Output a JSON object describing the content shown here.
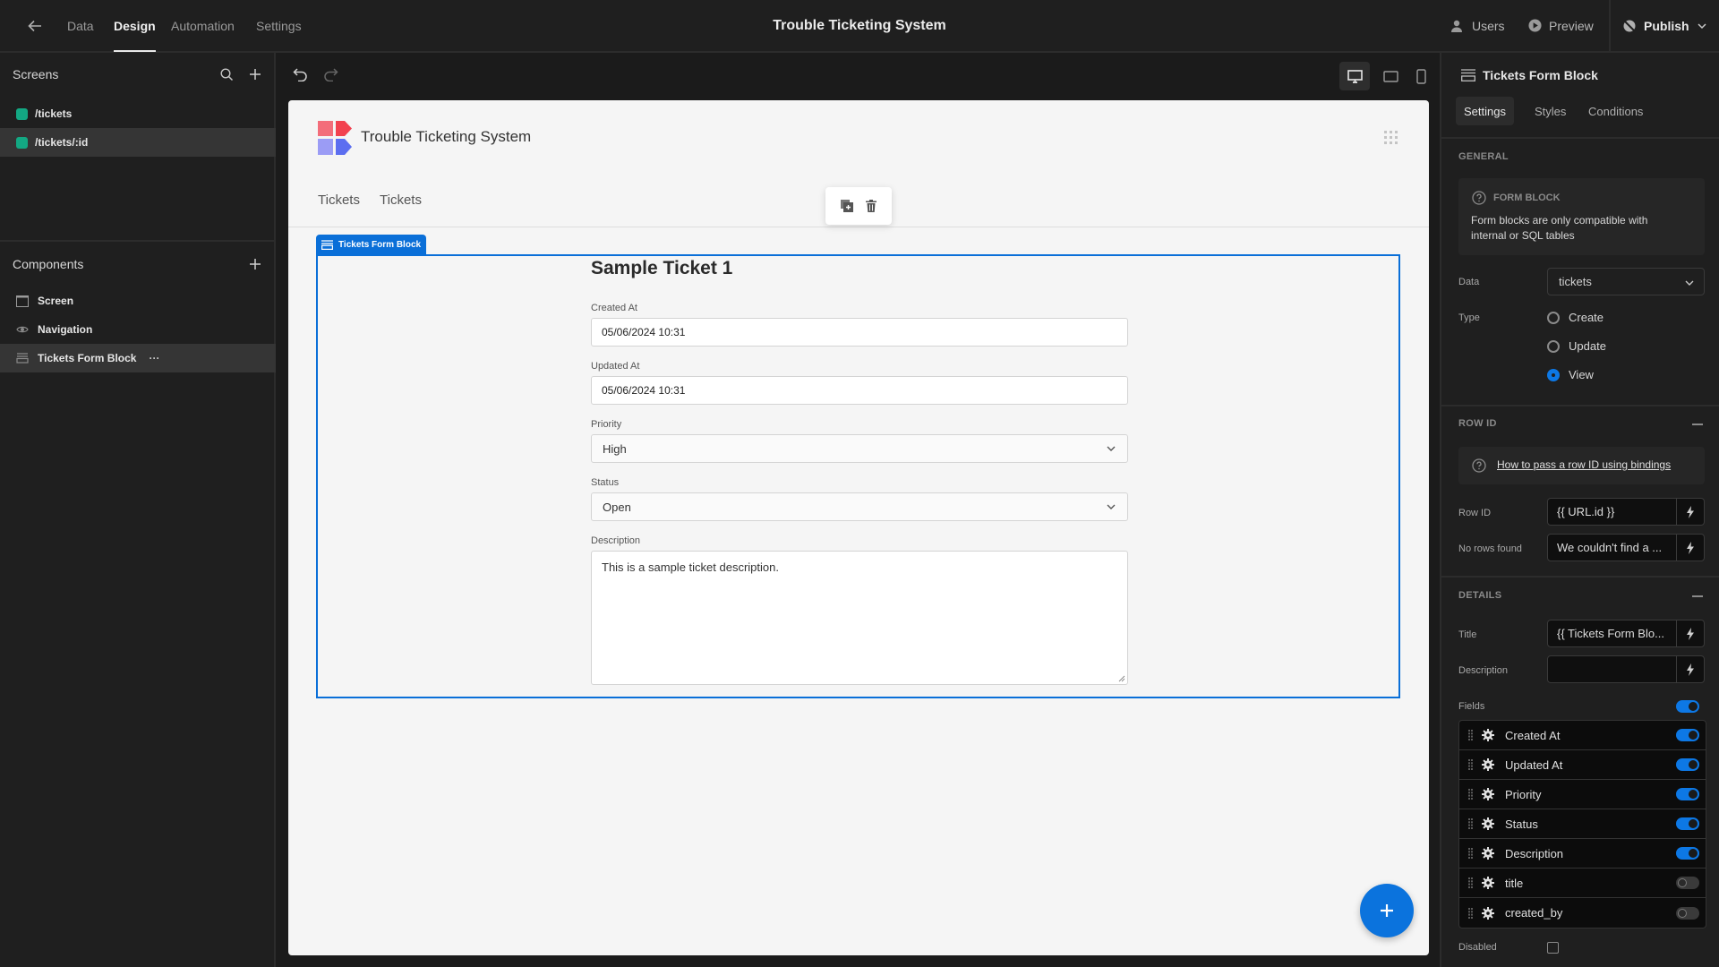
{
  "topbar": {
    "back_icon": "arrow-left-icon",
    "nav": [
      {
        "label": "Data",
        "active": false
      },
      {
        "label": "Design",
        "active": true
      },
      {
        "label": "Automation",
        "active": false
      },
      {
        "label": "Settings",
        "active": false
      }
    ],
    "title": "Trouble Ticketing System",
    "users_label": "Users",
    "preview_label": "Preview",
    "publish_label": "Publish"
  },
  "left_panel": {
    "screens_heading": "Screens",
    "screens": [
      {
        "path": "/tickets",
        "color": "#13a883",
        "selected": false
      },
      {
        "path": "/tickets/:id",
        "color": "#13a883",
        "selected": true
      }
    ],
    "components_heading": "Components",
    "components": [
      {
        "label": "Screen",
        "icon": "screen-icon",
        "selected": false
      },
      {
        "label": "Navigation",
        "icon": "eye-icon",
        "selected": false
      },
      {
        "label": "Tickets Form Block",
        "icon": "form-icon",
        "selected": true,
        "more": "···"
      }
    ]
  },
  "canvas": {
    "app_name": "Trouble Ticketing System",
    "nav_links": [
      "Tickets",
      "Tickets"
    ],
    "block_tab_label": "Tickets Form Block",
    "form": {
      "title": "Sample Ticket 1",
      "fields": [
        {
          "label": "Created At",
          "value": "05/06/2024 10:31",
          "type": "datetime"
        },
        {
          "label": "Updated At",
          "value": "05/06/2024 10:31",
          "type": "datetime"
        },
        {
          "label": "Priority",
          "value": "High",
          "type": "select"
        },
        {
          "label": "Status",
          "value": "Open",
          "type": "select"
        },
        {
          "label": "Description",
          "value": "This is a sample ticket description.",
          "type": "longform"
        }
      ]
    },
    "accent_color": "#0a6fd8"
  },
  "right_panel": {
    "title": "Tickets Form Block",
    "tabs": [
      {
        "label": "Settings",
        "active": true
      },
      {
        "label": "Styles",
        "active": false
      },
      {
        "label": "Conditions",
        "active": false
      }
    ],
    "general": {
      "heading": "GENERAL",
      "info_title": "FORM BLOCK",
      "info_text": "Form blocks are only compatible with internal or SQL tables",
      "data_label": "Data",
      "data_value": "tickets",
      "type_label": "Type",
      "type_options": [
        {
          "label": "Create",
          "checked": false
        },
        {
          "label": "Update",
          "checked": false
        },
        {
          "label": "View",
          "checked": true
        }
      ]
    },
    "row_id": {
      "heading": "ROW ID",
      "help_link": "How to pass a row ID using bindings",
      "row_id_label": "Row ID",
      "row_id_value": "{{ URL.id }}",
      "no_rows_label": "No rows found",
      "no_rows_value": "We couldn't find a ..."
    },
    "details": {
      "heading": "DETAILS",
      "title_label": "Title",
      "title_value": "{{ Tickets Form Blo...",
      "description_label": "Description",
      "description_value": "",
      "fields_label": "Fields",
      "fields_enabled": true,
      "fields": [
        {
          "name": "Created At",
          "enabled": true
        },
        {
          "name": "Updated At",
          "enabled": true
        },
        {
          "name": "Priority",
          "enabled": true
        },
        {
          "name": "Status",
          "enabled": true
        },
        {
          "name": "Description",
          "enabled": true
        },
        {
          "name": "title",
          "enabled": false
        },
        {
          "name": "created_by",
          "enabled": false
        }
      ],
      "disabled_label": "Disabled",
      "disabled_checked": false
    }
  }
}
